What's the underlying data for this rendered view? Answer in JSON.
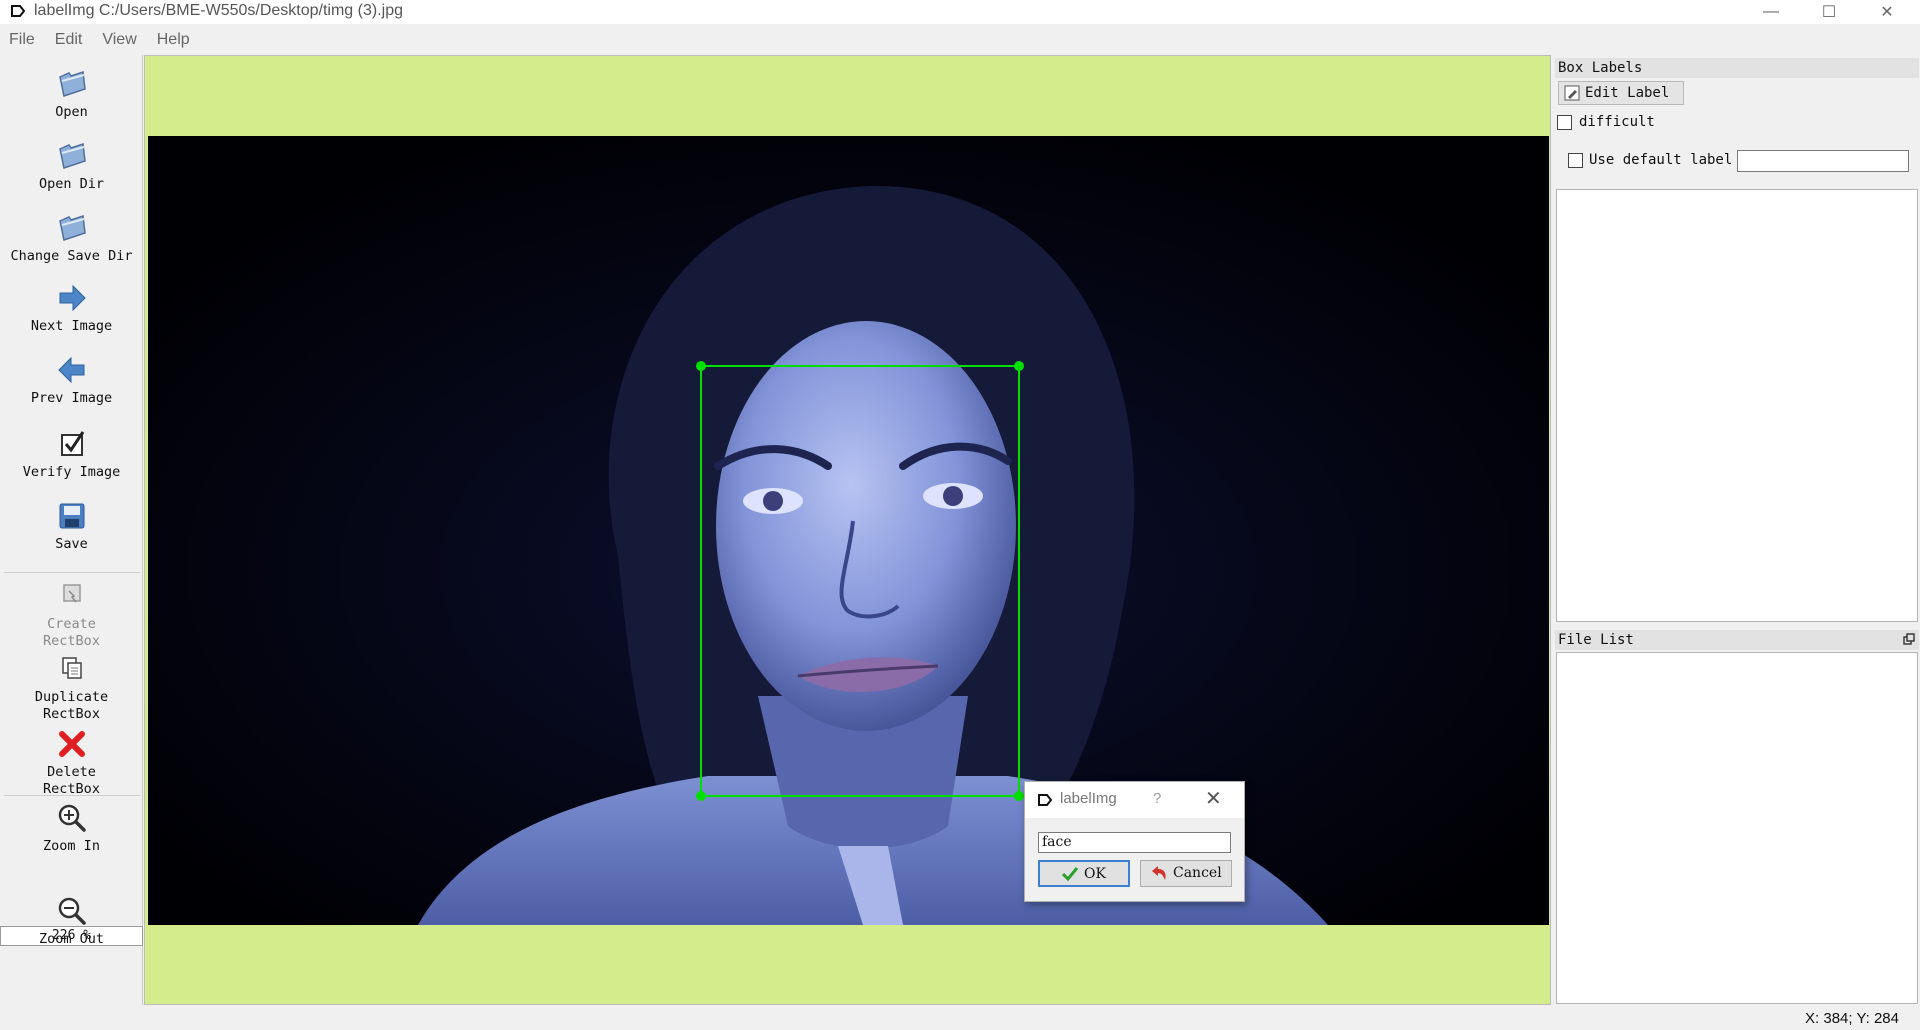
{
  "window": {
    "title": "labelImg C:/Users/BME-W550s/Desktop/timg (3).jpg",
    "controls": {
      "minimize": "—",
      "maximize": "☐",
      "close": "✕"
    }
  },
  "menu": [
    "File",
    "Edit",
    "View",
    "Help"
  ],
  "toolbar": {
    "open": "Open",
    "open_dir": "Open Dir",
    "change_save_dir": "Change Save Dir",
    "next_image": "Next Image",
    "prev_image": "Prev Image",
    "verify_image": "Verify Image",
    "save": "Save",
    "create_rectbox": "Create\nRectBox",
    "duplicate_rectbox": "Duplicate\nRectBox",
    "delete_rectbox": "Delete\nRectBox",
    "zoom_in": "Zoom In",
    "zoom_value": "226 %",
    "zoom_out": "Zoom Out",
    "extension_glyph": "⌄"
  },
  "right_panel": {
    "box_labels_title": "Box Labels",
    "edit_label_button": "Edit Label",
    "difficult_label": "difficult",
    "difficult_checked": false,
    "use_default_label": "Use default label",
    "use_default_checked": false,
    "default_label_value": "",
    "file_list_title": "File List"
  },
  "status": {
    "coords": "X: 384; Y: 284"
  },
  "dialog": {
    "title": "labelImg",
    "help": "?",
    "close": "✕",
    "input_value": "face",
    "ok_label": "OK",
    "cancel_label": "Cancel"
  },
  "colors": {
    "canvas_bg": "#d4ec8c",
    "bbox": "#00e000",
    "accent": "#3c7fd0"
  }
}
